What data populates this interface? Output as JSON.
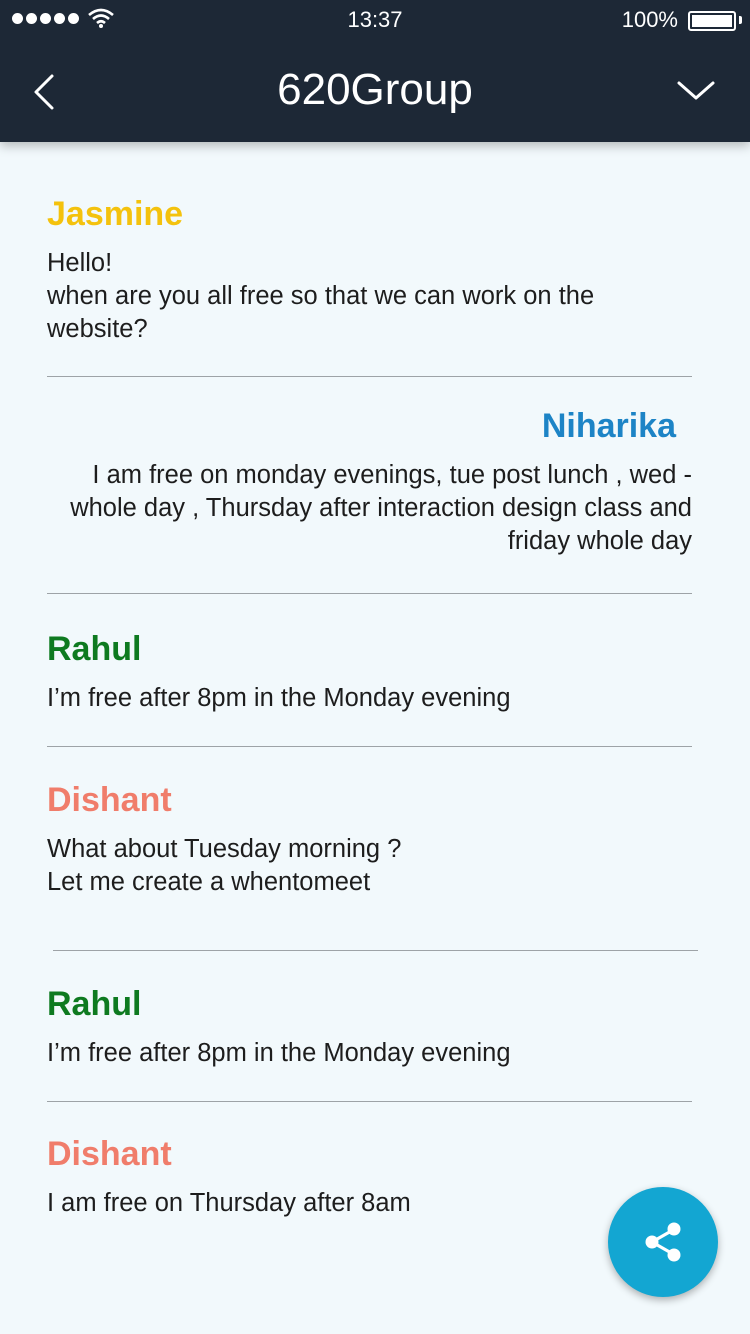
{
  "status_bar": {
    "time": "13:37",
    "battery_percent": "100%",
    "battery_level": 1.0,
    "signal_bars": 5
  },
  "header": {
    "title": "620Group",
    "back_icon": "chevron-left-icon",
    "menu_icon": "chevron-down-icon"
  },
  "messages": [
    {
      "sender": "Jasmine",
      "color": "#f4c20d",
      "align": "left",
      "text": "Hello!\nwhen are you all free so that we can work on the website?"
    },
    {
      "sender": "Niharika",
      "color": "#1d84c6",
      "align": "right",
      "text": "I am free on monday evenings, tue post lunch , wed - whole day , Thursday after interaction design class and friday whole day"
    },
    {
      "sender": "Rahul",
      "color": "#0e7a20",
      "align": "left",
      "text": "I’m free after 8pm in the Monday evening"
    },
    {
      "sender": "Dishant",
      "color": "#f07d6b",
      "align": "left",
      "text": "What about Tuesday morning ?\nLet me create a whentomeet"
    },
    {
      "sender": "Rahul",
      "color": "#0e7a20",
      "align": "left",
      "text": "I’m free after 8pm in the Monday evening"
    },
    {
      "sender": "Dishant",
      "color": "#f07d6b",
      "align": "left",
      "text": "I am free on Thursday after 8am"
    }
  ],
  "fab": {
    "icon": "share-icon",
    "color": "#13a6d2"
  }
}
